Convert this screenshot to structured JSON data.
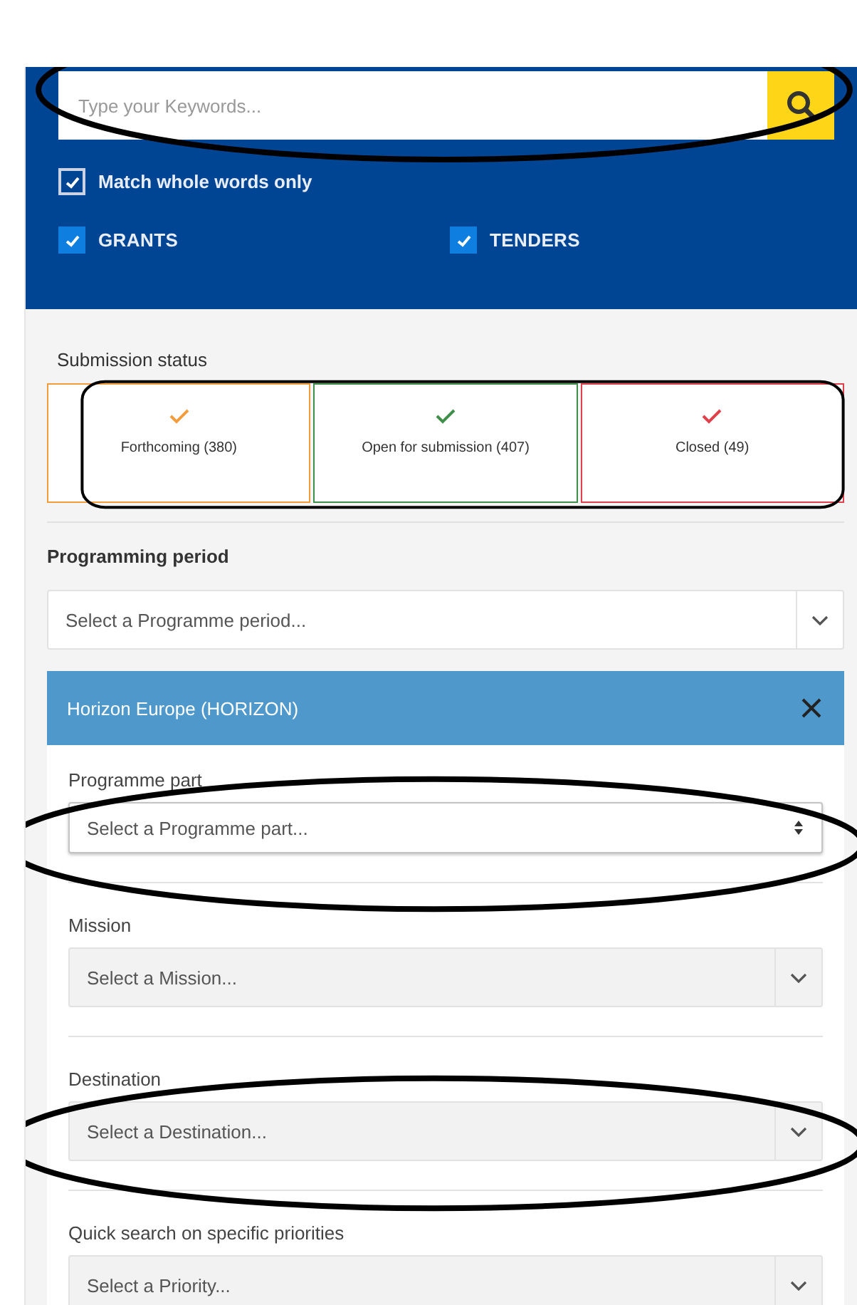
{
  "search": {
    "placeholder": "Type your Keywords...",
    "circled": true
  },
  "match_whole_words": {
    "label": "Match whole words only",
    "checked": true
  },
  "types": [
    {
      "label": "GRANTS",
      "checked": true
    },
    {
      "label": "TENDERS",
      "checked": true
    }
  ],
  "submission_status": {
    "title": "Submission status",
    "boxed": true,
    "items": [
      {
        "label": "Forthcoming (380)",
        "color": "#f39c3c"
      },
      {
        "label": "Open for submission (407)",
        "color": "#3f8f4a"
      },
      {
        "label": "Closed (49)",
        "color": "#e0404a"
      }
    ]
  },
  "programming_period": {
    "title": "Programming period",
    "placeholder": "Select a Programme period..."
  },
  "programme": {
    "title": "Horizon Europe (HORIZON)",
    "filters": [
      {
        "label": "Programme part",
        "placeholder": "Select a Programme part...",
        "kind": "spinner",
        "circled": true
      },
      {
        "label": "Mission",
        "placeholder": "Select a Mission...",
        "kind": "dropdown",
        "circled": false
      },
      {
        "label": "Destination",
        "placeholder": "Select a Destination...",
        "kind": "dropdown",
        "circled": true
      },
      {
        "label": "Quick search on specific priorities",
        "placeholder": "Select a Priority...",
        "kind": "dropdown",
        "circled": false
      }
    ]
  }
}
